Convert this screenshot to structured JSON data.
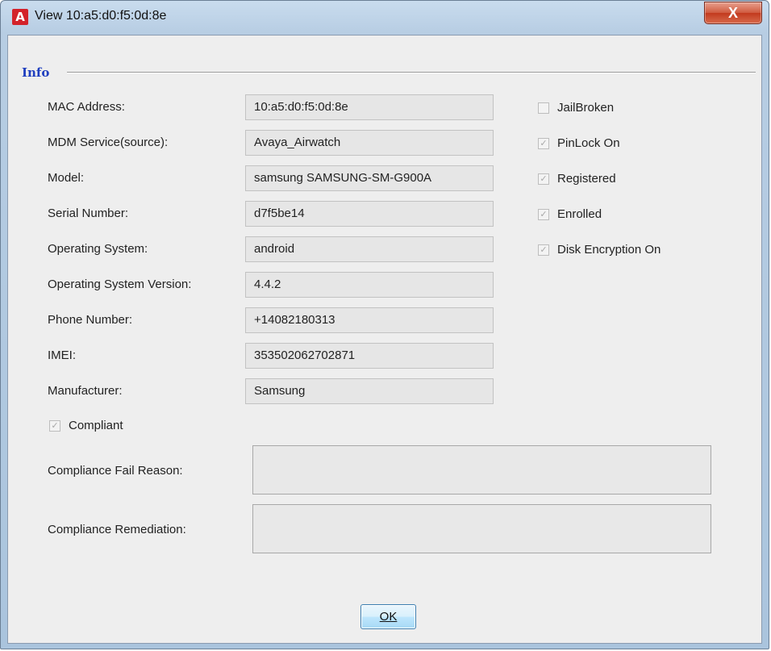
{
  "window": {
    "title": "View 10:a5:d0:f5:0d:8e",
    "app_icon_letter": "A",
    "close_glyph": "X"
  },
  "info_group": {
    "header": "Info",
    "fields": [
      {
        "label": "MAC Address:",
        "value": "10:a5:d0:f5:0d:8e"
      },
      {
        "label": "MDM Service(source):",
        "value": "Avaya_Airwatch"
      },
      {
        "label": "Model:",
        "value": "samsung SAMSUNG-SM-G900A"
      },
      {
        "label": "Serial Number:",
        "value": "d7f5be14"
      },
      {
        "label": "Operating System:",
        "value": "android"
      },
      {
        "label": "Operating System Version:",
        "value": "4.4.2"
      },
      {
        "label": "Phone Number:",
        "value": "+14082180313"
      },
      {
        "label": "IMEI:",
        "value": "353502062702871"
      },
      {
        "label": "Manufacturer:",
        "value": "Samsung"
      }
    ],
    "flags": [
      {
        "label": "JailBroken",
        "checked": false
      },
      {
        "label": "PinLock On",
        "checked": true
      },
      {
        "label": "Registered",
        "checked": true
      },
      {
        "label": "Enrolled",
        "checked": true
      },
      {
        "label": "Disk Encryption On",
        "checked": true
      }
    ],
    "compliant": {
      "label": "Compliant",
      "checked": true
    },
    "compliance_fail_reason": {
      "label": "Compliance Fail Reason:",
      "value": ""
    },
    "compliance_remediation": {
      "label": "Compliance Remediation:",
      "value": ""
    }
  },
  "buttons": {
    "ok_label": "OK"
  },
  "colors": {
    "title_bar": "#b7cde3",
    "client_bg": "#eeeeee",
    "group_header": "#1f3fbf",
    "close_button": "#c23a1e",
    "app_icon": "#d3222a"
  }
}
